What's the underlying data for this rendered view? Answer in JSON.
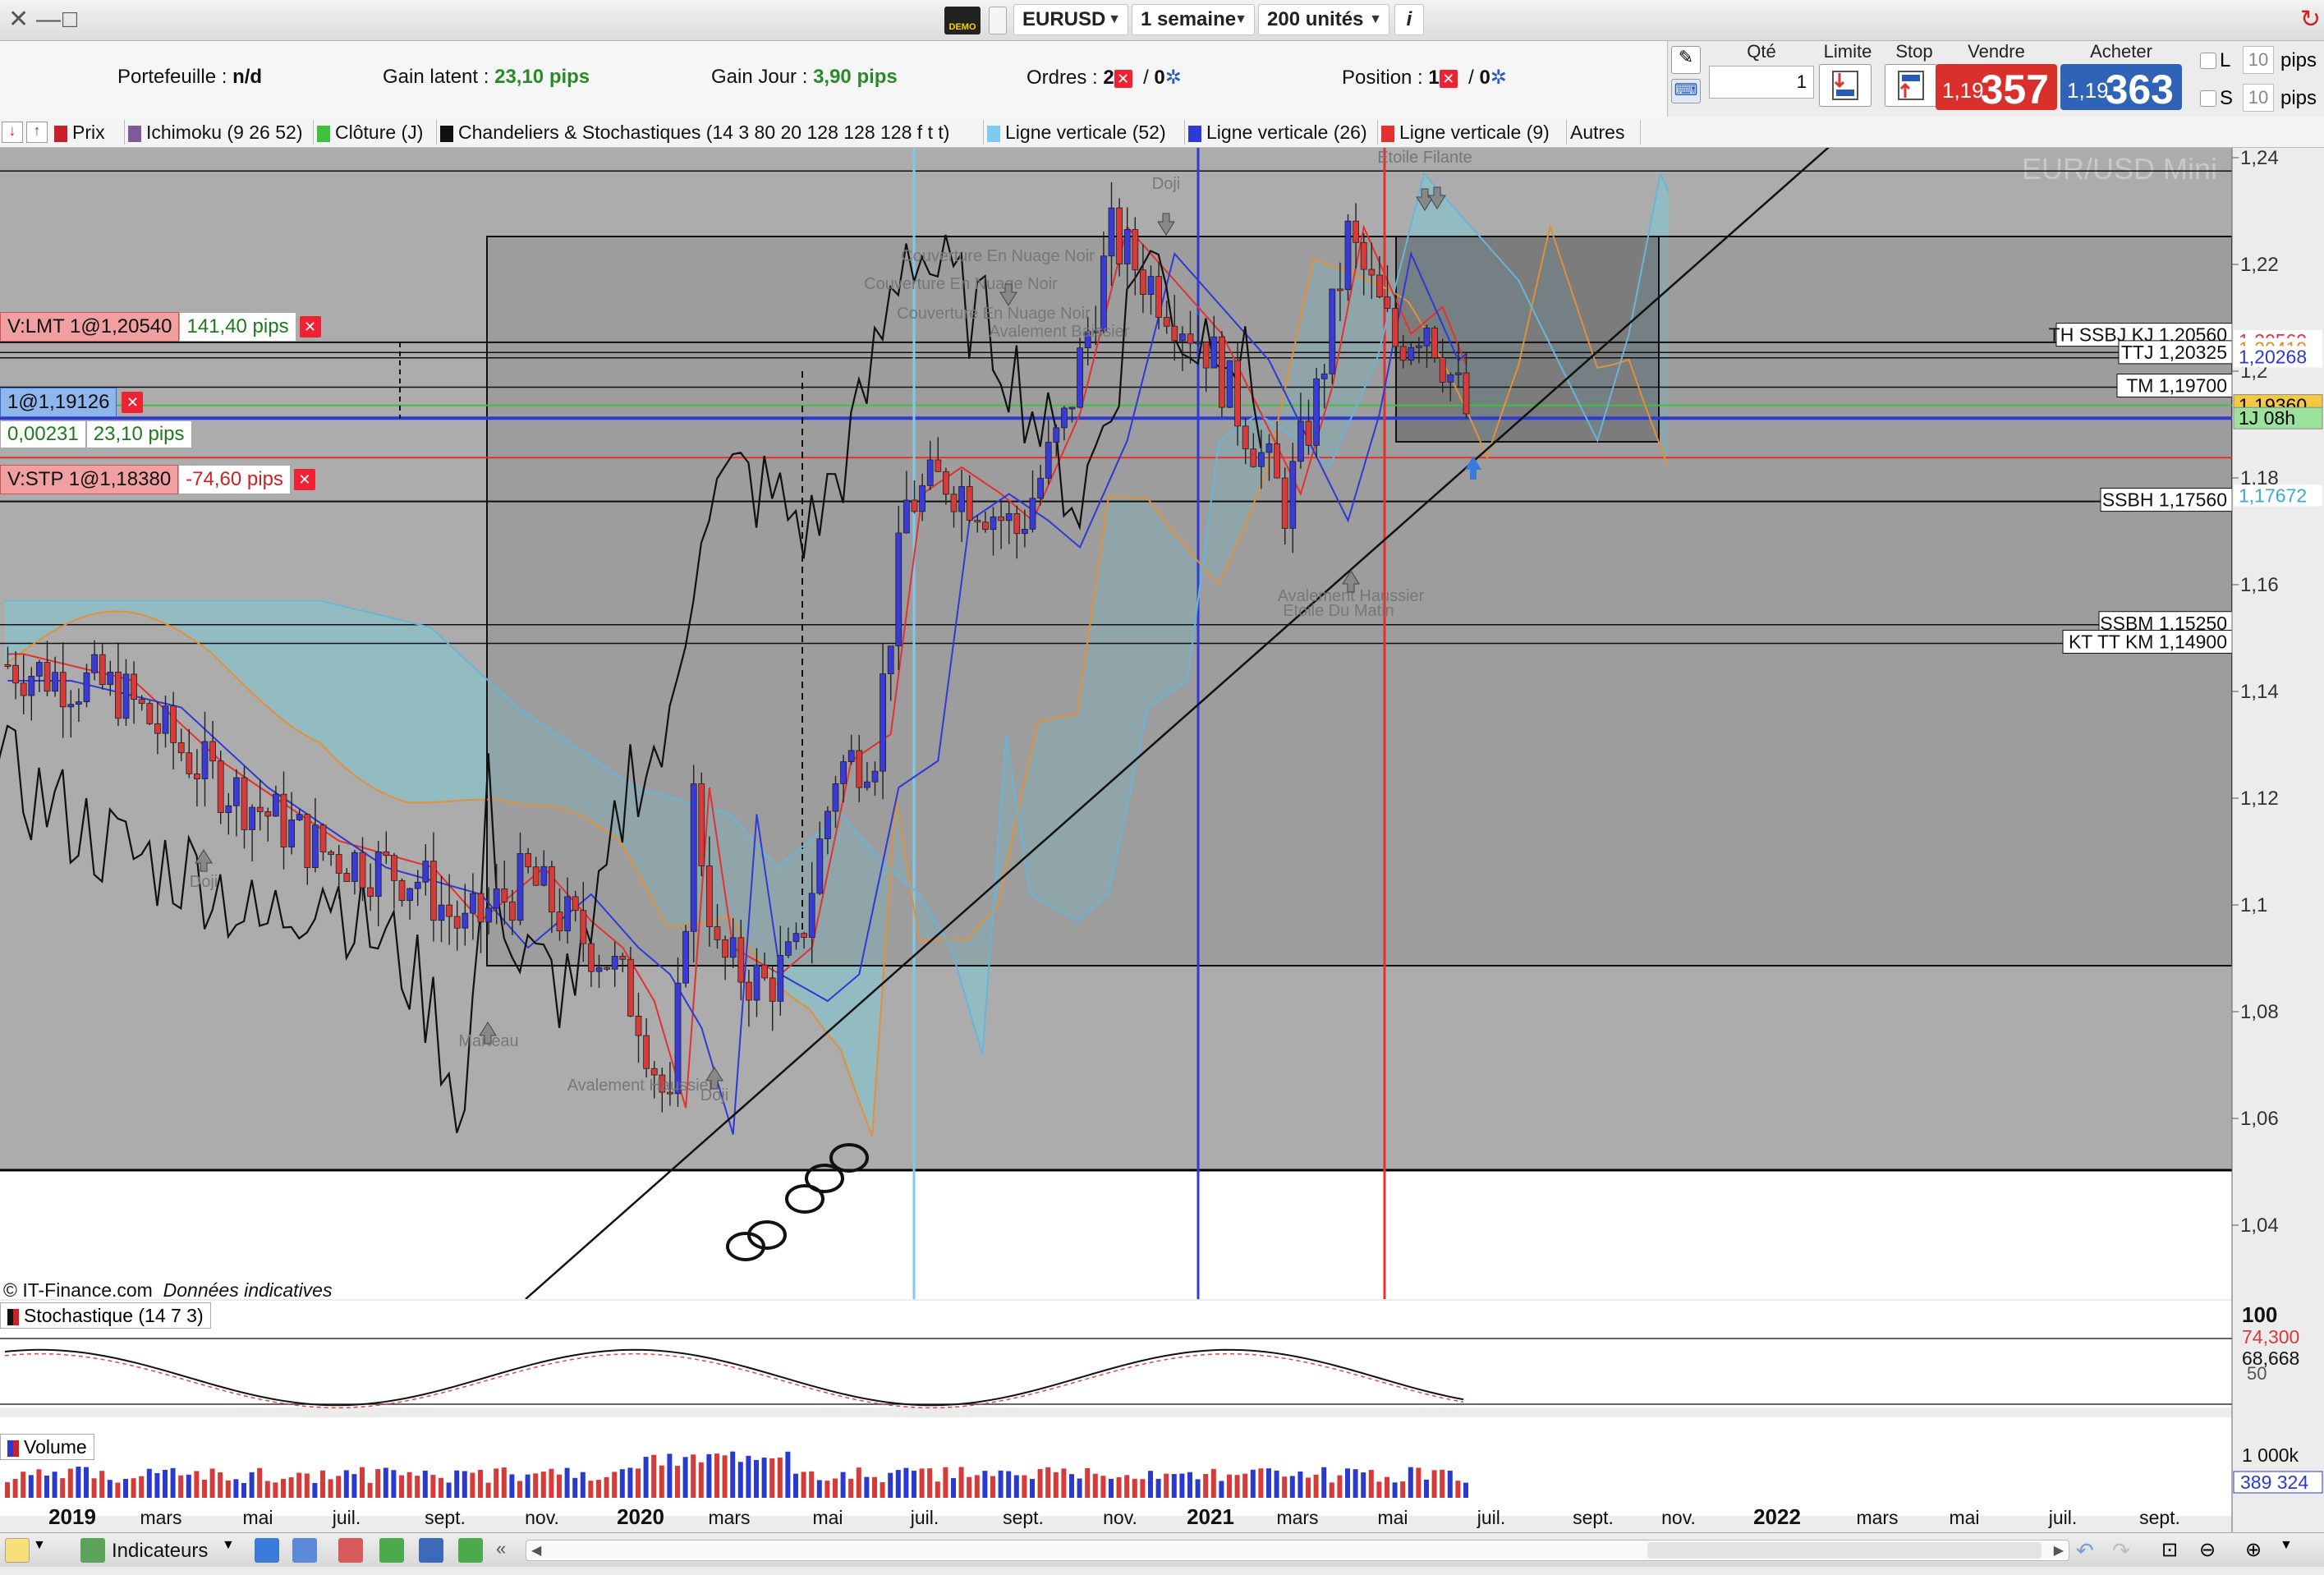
{
  "window": {
    "close_glyph": "✕",
    "minimize_glyph": "—",
    "maximize_glyph": "□"
  },
  "header": {
    "demo_badge": "DEMO",
    "symbol": "EURUSD",
    "period": "1 semaine",
    "units": "200 unités",
    "info_glyph": "i"
  },
  "infobar": {
    "portefeuille_label": "Portefeuille :",
    "portefeuille_value": "n/d",
    "gain_latent_label": "Gain latent :",
    "gain_latent_value": "23,10 pips",
    "gain_jour_label": "Gain Jour :",
    "gain_jour_value": "3,90 pips",
    "ordres_label": "Ordres :",
    "ordres_count": "2",
    "ordres_sep": "/",
    "ordres_second": "0",
    "position_label": "Position :",
    "position_count": "1",
    "position_sep": "/",
    "position_second": "0"
  },
  "trade": {
    "qte_label": "Qté",
    "qte_value": "1",
    "limite_label": "Limite",
    "stop_label": "Stop",
    "vendre_label": "Vendre",
    "vendre_small": "1,19",
    "vendre_large": "357",
    "acheter_label": "Acheter",
    "acheter_small": "1,19",
    "acheter_large": "363",
    "l_label": "L",
    "l_value": "10",
    "l_unit": "pips",
    "s_label": "S",
    "s_value": "10",
    "s_unit": "pips",
    "sell_color": "#d9302c",
    "buy_color": "#2f63b8"
  },
  "indicators": [
    {
      "label": "Prix",
      "color": "#c8202a"
    },
    {
      "label": "Ichimoku (9 26 52)",
      "color": "#7d5a9a"
    },
    {
      "label": "Clôture (J)",
      "color": "#3ec23e"
    },
    {
      "label": "Chandeliers & Stochastiques (14 3 80 20 128 128 128 f t t)",
      "color": "#111111"
    },
    {
      "label": "Ligne verticale (52)",
      "color": "#7ec9ef"
    },
    {
      "label": "Ligne verticale (26)",
      "color": "#2d3ad6"
    },
    {
      "label": "Ligne verticale (9)",
      "color": "#e53030"
    },
    {
      "label": "Autres",
      "color": ""
    }
  ],
  "chart": {
    "watermark": "EUR/USD Mini",
    "copyright": "© IT-Finance.com",
    "copyright_note": "Données indicatives",
    "yticks": [
      "1,24",
      "1,22",
      "1,2",
      "1,18",
      "1,16",
      "1,14",
      "1,12",
      "1,1",
      "1,08",
      "1,06",
      "1,04"
    ],
    "xticks": [
      "2019",
      "mars",
      "mai",
      "juil.",
      "sept.",
      "nov.",
      "2020",
      "mars",
      "mai",
      "juil.",
      "sept.",
      "nov.",
      "2021",
      "mars",
      "mai",
      "juil.",
      "sept.",
      "nov.",
      "2022",
      "mars",
      "mai",
      "juil.",
      "sept."
    ],
    "orders": {
      "lmt_label": "V:LMT  1@1,20540",
      "lmt_pips": "141,40 pips",
      "pos_label": "1@1,19126",
      "pos_delta": "0,00231",
      "pos_pips": "23,10 pips",
      "stp_label": "V:STP  1@1,18380",
      "stp_pips": "-74,60 pips"
    },
    "level_labels": [
      {
        "text": "TH SSBJ KJ 1,20560"
      },
      {
        "text": "TTJ 1,20325"
      },
      {
        "text": "TM 1,19700"
      },
      {
        "text": "SSBH 1,17560"
      },
      {
        "text": "SSBM 1,15250"
      },
      {
        "text": "KT TT KM 1,14900"
      }
    ],
    "right_tags": [
      {
        "text": "1,20569",
        "color": "#e23030",
        "bg": "#ffffff"
      },
      {
        "text": "1,20419",
        "color": "#e08a20",
        "bg": "#ffffff"
      },
      {
        "text": "1,20268",
        "color": "#2a3ad0",
        "bg": "#ffffff"
      },
      {
        "text": "1,19360",
        "color": "#000000",
        "bg": "#f5c842"
      },
      {
        "text": "1J 08h",
        "color": "#000000",
        "bg": "#9be39b"
      },
      {
        "text": "1,17672",
        "color": "#3aa8d8",
        "bg": "#ffffff"
      }
    ],
    "annotations": [
      "Doji",
      "Couverture En Nuage Noir",
      "Couverture En Nuage Noir",
      "Couverture En Nuage Noir",
      "Avalement Baissier",
      "Etoile Filante",
      "Doji",
      "Marteau",
      "Avalement Haussier",
      "Doji",
      "Avalement Haussier",
      "Etoile Du Matin"
    ]
  },
  "stochastic": {
    "title": "Stochastique (14 7 3)",
    "top_tick": "100",
    "value_a": "74,300",
    "value_b": "68,668",
    "mid_tick": "50"
  },
  "volume": {
    "title": "Volume",
    "top_tick": "1 000k",
    "value": "389 324"
  },
  "bottombar": {
    "indicators_label": "Indicateurs"
  }
}
